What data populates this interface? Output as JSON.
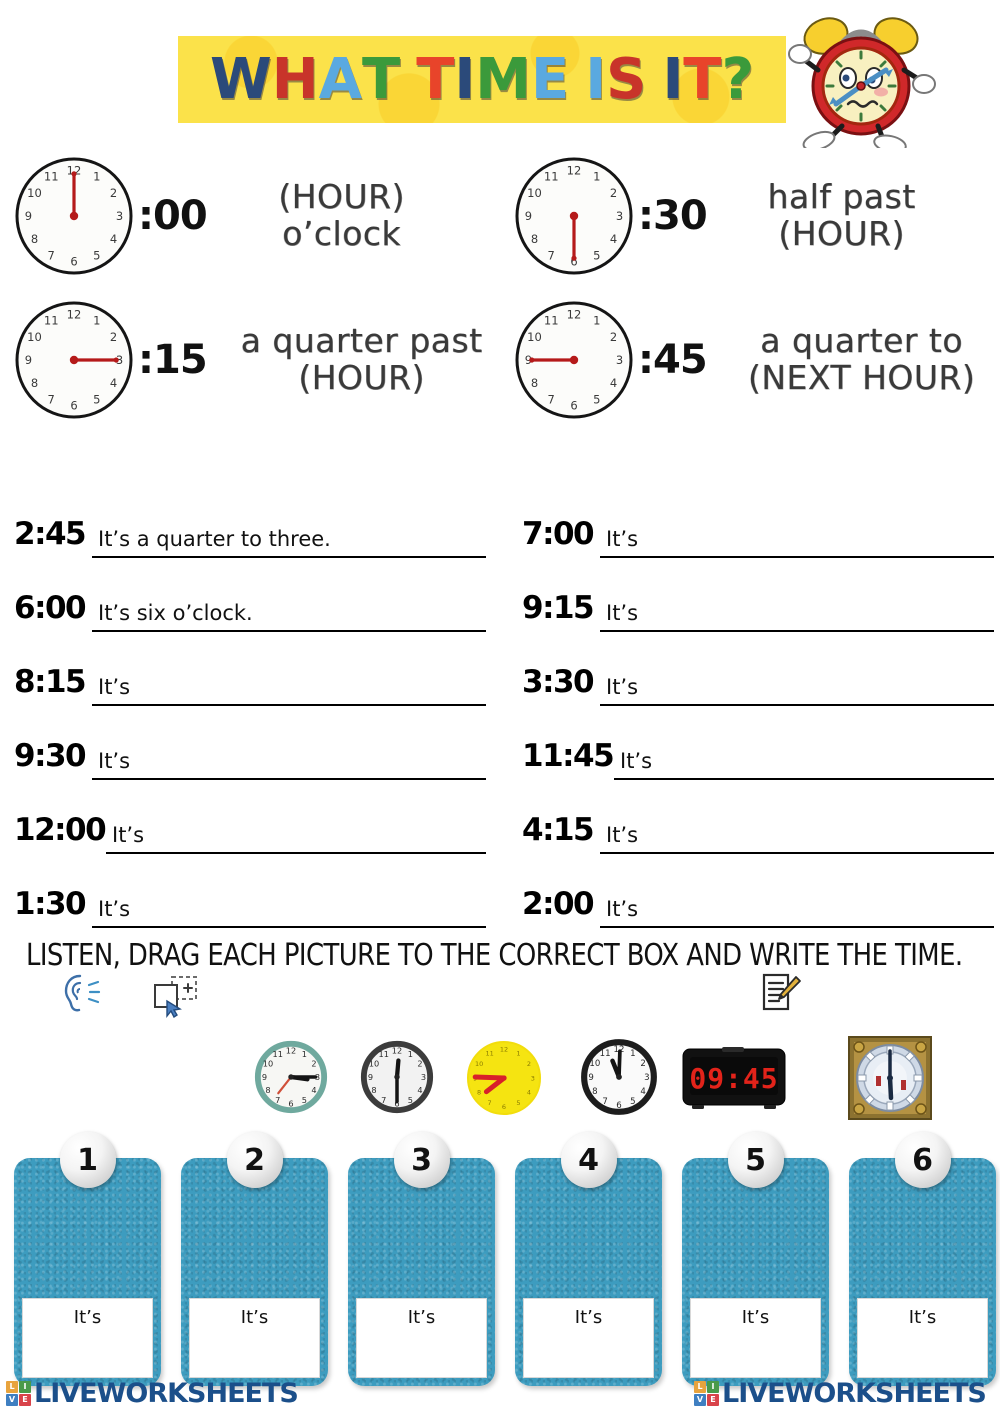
{
  "header": {
    "title_parts": [
      {
        "t": "W",
        "color": "#2b4a7a",
        "size": "cap"
      },
      {
        "t": "H",
        "color": "#c8342a",
        "size": "sm"
      },
      {
        "t": "A",
        "color": "#5aa9e0",
        "size": "sm"
      },
      {
        "t": "T",
        "color": "#3b9a3b",
        "size": "cap"
      },
      {
        "t": " ",
        "color": "#000000",
        "size": "sp"
      },
      {
        "t": "T",
        "color": "#e8442a",
        "size": "cap"
      },
      {
        "t": "I",
        "color": "#2b4a7a",
        "size": "sm"
      },
      {
        "t": "M",
        "color": "#3b9a3b",
        "size": "sm"
      },
      {
        "t": "E",
        "color": "#5aa9e0",
        "size": "sm"
      },
      {
        "t": " ",
        "color": "#000000",
        "size": "sp"
      },
      {
        "t": "I",
        "color": "#5aa9e0",
        "size": "cap"
      },
      {
        "t": "S",
        "color": "#c8342a",
        "size": "sm"
      },
      {
        "t": " ",
        "color": "#000000",
        "size": "sp"
      },
      {
        "t": "I",
        "color": "#2b4a7a",
        "size": "cap"
      },
      {
        "t": "T",
        "color": "#e8442a",
        "size": "cap"
      },
      {
        "t": "?",
        "color": "#3b9a3b",
        "size": "cap"
      }
    ],
    "title_plain": "WHAT TIME IS IT?",
    "banner_color": "#fbe24a",
    "mascot_label": "cartoon alarm clock mascot"
  },
  "legend": [
    {
      "id": "oclock",
      "minute_label": ":00",
      "phrase_line1": "(HOUR)",
      "phrase_line2": "o’clock",
      "clock_minute_angle": 0,
      "hand_color": "#b51a1a"
    },
    {
      "id": "half-past",
      "minute_label": ":30",
      "phrase_line1": "half past",
      "phrase_line2": "(HOUR)",
      "clock_minute_angle": 180,
      "hand_color": "#b51a1a"
    },
    {
      "id": "quarter-past",
      "minute_label": ":15",
      "phrase_line1": "a quarter past",
      "phrase_line2": "(HOUR)",
      "clock_minute_angle": 90,
      "hand_color": "#b51a1a"
    },
    {
      "id": "quarter-to",
      "minute_label": ":45",
      "phrase_line1": "a quarter to",
      "phrase_line2": "(NEXT HOUR)",
      "clock_minute_angle": 270,
      "hand_color": "#b51a1a"
    }
  ],
  "exercise": {
    "prefix": "It’s",
    "left": [
      {
        "time": "2:45",
        "answer": "It’s a quarter to three."
      },
      {
        "time": "6:00",
        "answer": "It’s six o’clock."
      },
      {
        "time": "8:15",
        "answer": "It’s"
      },
      {
        "time": "9:30",
        "answer": "It’s"
      },
      {
        "time": "12:00",
        "answer": "It’s"
      },
      {
        "time": "1:30",
        "answer": "It’s"
      }
    ],
    "right": [
      {
        "time": "7:00",
        "answer": "It’s"
      },
      {
        "time": "9:15",
        "answer": "It’s"
      },
      {
        "time": "3:30",
        "answer": "It’s"
      },
      {
        "time": "11:45",
        "answer": "It’s"
      },
      {
        "time": "4:15",
        "answer": "It’s"
      },
      {
        "time": "2:00",
        "answer": "It’s"
      }
    ]
  },
  "task2": {
    "instruction": "LISTEN, DRAG EACH PICTURE TO THE CORRECT BOX AND WRITE THE TIME.",
    "icons": [
      "ear-listen-icon",
      "drag-drop-icon",
      "write-note-icon"
    ],
    "pictures": [
      {
        "name": "teal-wall-clock",
        "type": "analog",
        "rim_color": "#6fa99e",
        "face_color": "#f7f7f4",
        "hour_angle": 98,
        "minute_angle": 90,
        "second_angle": 218,
        "second_color": "#d0503a"
      },
      {
        "name": "grey-wall-clock",
        "type": "analog",
        "rim_color": "#3c3c3c",
        "face_color": "#f2f2f2",
        "hour_angle": 5,
        "minute_angle": 180,
        "second_angle": 0,
        "second_color": "none"
      },
      {
        "name": "yellow-wall-clock",
        "type": "analog",
        "rim_color": "#f2dd0c",
        "face_color": "#f5e411",
        "hour_angle": 232,
        "minute_angle": 272,
        "second_angle": 0,
        "second_color": "#d8202a"
      },
      {
        "name": "black-wall-clock",
        "type": "analog",
        "rim_color": "#1d1d1d",
        "face_color": "#fafafa",
        "hour_angle": 338,
        "minute_angle": 2,
        "second_angle": 0,
        "second_color": "none"
      },
      {
        "name": "digital-alarm-clock",
        "type": "digital",
        "display": "09:45",
        "display_color": "#e2231a",
        "case_color": "#111111"
      },
      {
        "name": "big-ben-clock-face",
        "type": "landmark",
        "frame_color": "#b49243",
        "face_color": "#dfe6ee",
        "hour_angle": 178,
        "minute_angle": 2
      }
    ],
    "dropboxes": [
      {
        "number": "1",
        "answer_prefix": "It’s"
      },
      {
        "number": "2",
        "answer_prefix": "It’s"
      },
      {
        "number": "3",
        "answer_prefix": "It’s"
      },
      {
        "number": "4",
        "answer_prefix": "It’s"
      },
      {
        "number": "5",
        "answer_prefix": "It’s"
      },
      {
        "number": "6",
        "answer_prefix": "It’s"
      }
    ],
    "dropbox_color": "#3d9cbf"
  },
  "footer": {
    "brand": "LIVEWORKSHEETS",
    "brand_color": "#1b4f8a",
    "cubes": [
      {
        "letter": "L",
        "color": "#e8a33d"
      },
      {
        "letter": "I",
        "color": "#4a9a4a"
      },
      {
        "letter": "V",
        "color": "#3f7fc1"
      },
      {
        "letter": "E",
        "color": "#d8434a"
      }
    ]
  }
}
